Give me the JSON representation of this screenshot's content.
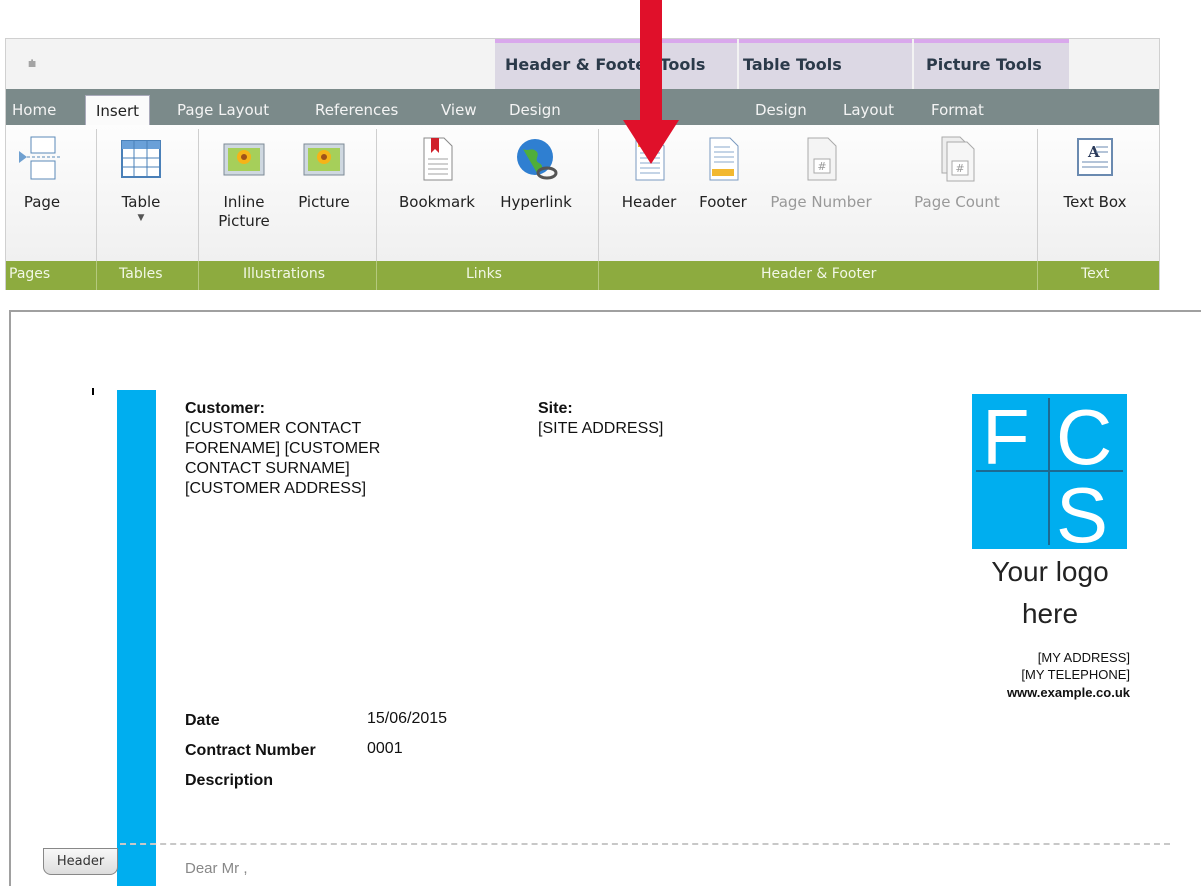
{
  "ribbon": {
    "quick_access": "⩧",
    "contextual_groups": [
      "Header & Footer Tools",
      "Table Tools",
      "Picture Tools"
    ],
    "tabs": [
      "Home",
      "Insert",
      "Page Layout",
      "References",
      "View",
      "Design",
      "Design",
      "Layout",
      "Format"
    ],
    "active_tab": "Insert",
    "buttons": {
      "page": "Page",
      "table": "Table",
      "inline_picture": "Inline Picture",
      "picture": "Picture",
      "bookmark": "Bookmark",
      "hyperlink": "Hyperlink",
      "header": "Header",
      "footer": "Footer",
      "page_number": "Page Number",
      "page_count": "Page Count",
      "text_box": "Text Box"
    },
    "groups": [
      "Pages",
      "Tables",
      "Illustrations",
      "Links",
      "Header & Footer",
      "Text"
    ],
    "colors": {
      "group_bar": "#8dab3f",
      "tab_bar": "#7b8a8a",
      "arrow": "#e0102a"
    }
  },
  "document": {
    "customer_label": "Customer:",
    "customer_lines": [
      "[CUSTOMER CONTACT",
      "FORENAME] [CUSTOMER",
      "CONTACT SURNAME]",
      "[CUSTOMER ADDRESS]"
    ],
    "site_label": "Site:",
    "site_value": "[SITE ADDRESS]",
    "logo_letters": [
      "F",
      "C",
      "S"
    ],
    "logo_text": [
      "Your logo",
      "here"
    ],
    "address_lines": [
      "[MY ADDRESS]",
      "[MY TELEPHONE]"
    ],
    "website": "www.example.co.uk",
    "fields": [
      {
        "label": "Date",
        "value": "15/06/2015"
      },
      {
        "label": "Contract Number",
        "value": "0001"
      },
      {
        "label": "Description",
        "value": ""
      }
    ],
    "header_tag": "Header",
    "salutation": "Dear Mr ,",
    "accent_color": "#00aeef"
  }
}
